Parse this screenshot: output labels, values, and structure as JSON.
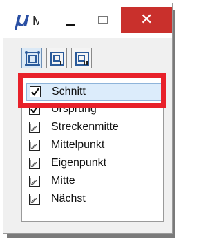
{
  "window": {
    "title": "M",
    "app_icon": "microstation-mu-icon",
    "controls": {
      "minimize": "minimize-icon",
      "maximize": "maximize-icon",
      "close": "close-icon",
      "close_glyph": "✕"
    }
  },
  "toolbar": {
    "buttons": [
      {
        "icon": "snap-mode-icon-1",
        "active": true
      },
      {
        "icon": "snap-mode-icon-2",
        "active": false
      },
      {
        "icon": "snap-mode-icon-3",
        "active": false
      }
    ]
  },
  "snap_list": {
    "items": [
      {
        "label": "Schnitt",
        "checked": true,
        "selected": true
      },
      {
        "label": "Ursprung",
        "checked": true,
        "selected": false
      },
      {
        "label": "Streckenmitte",
        "checked": false,
        "selected": false
      },
      {
        "label": "Mittelpunkt",
        "checked": false,
        "selected": false
      },
      {
        "label": "Eigenpunkt",
        "checked": false,
        "selected": false
      },
      {
        "label": "Mitte",
        "checked": false,
        "selected": false
      },
      {
        "label": "Nächst",
        "checked": false,
        "selected": false
      }
    ]
  },
  "colors": {
    "close_button": "#c9302c",
    "highlight": "#e8212a",
    "selection": "#dcecfb",
    "app_icon": "#2a4fa3"
  }
}
